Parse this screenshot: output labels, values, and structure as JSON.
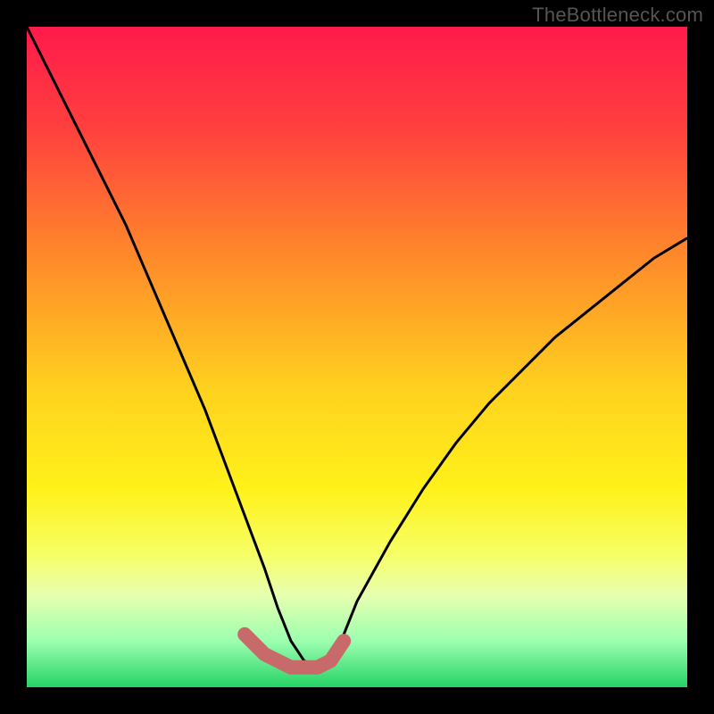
{
  "watermark": "TheBottleneck.com",
  "chart_data": {
    "type": "line",
    "title": "",
    "xlabel": "",
    "ylabel": "",
    "xlim": [
      0,
      100
    ],
    "ylim": [
      0,
      100
    ],
    "gradient_stops": [
      {
        "offset": 0,
        "color": "#ff1a4b"
      },
      {
        "offset": 15,
        "color": "#ff3f3f"
      },
      {
        "offset": 35,
        "color": "#ff8a2a"
      },
      {
        "offset": 55,
        "color": "#ffd21f"
      },
      {
        "offset": 70,
        "color": "#fff11a"
      },
      {
        "offset": 80,
        "color": "#f6ff66"
      },
      {
        "offset": 86,
        "color": "#e8ffb0"
      },
      {
        "offset": 93,
        "color": "#9cffb0"
      },
      {
        "offset": 100,
        "color": "#25d366"
      }
    ],
    "series": [
      {
        "name": "bottleneck-curve",
        "x": [
          0,
          3,
          6,
          9,
          12,
          15,
          18,
          21,
          24,
          27,
          30,
          33,
          36,
          38,
          40,
          42,
          44,
          46,
          48,
          50,
          55,
          60,
          65,
          70,
          75,
          80,
          85,
          90,
          95,
          100
        ],
        "values": [
          100,
          94,
          88,
          82,
          76,
          70,
          63,
          56,
          49,
          42,
          34,
          26,
          18,
          12,
          7,
          4,
          3,
          4,
          8,
          13,
          22,
          30,
          37,
          43,
          48,
          53,
          57,
          61,
          65,
          68
        ]
      },
      {
        "name": "highlight-segment",
        "x": [
          33,
          36,
          38,
          40,
          42,
          44,
          46,
          48
        ],
        "values": [
          8,
          5,
          4,
          3,
          3,
          3,
          4,
          7
        ]
      }
    ]
  }
}
